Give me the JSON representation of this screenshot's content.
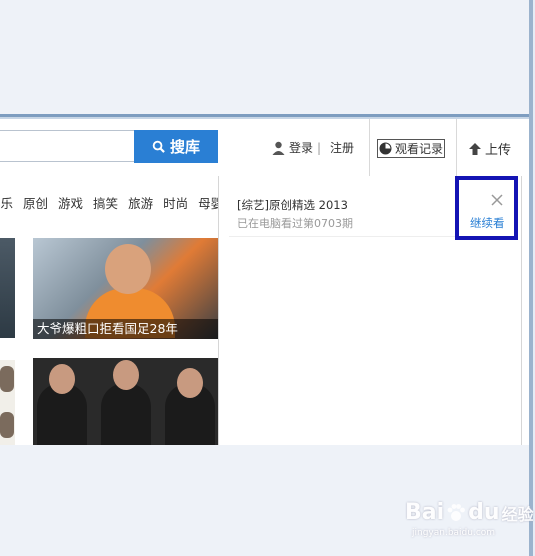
{
  "search": {
    "button_label": "搜库",
    "value": ""
  },
  "header": {
    "login": "登录",
    "divider": "|",
    "register": "注册",
    "history": "观看记录",
    "upload": "上传"
  },
  "nav": {
    "items": [
      "娱乐",
      "原创",
      "游戏",
      "搞笑",
      "旅游",
      "时尚",
      "母婴"
    ]
  },
  "thumbs": {
    "caption1": "大爷爆粗口拒看国足28年"
  },
  "history_panel": {
    "item_title": "[综艺]原创精选 2013",
    "item_sub": "已在电脑看过第0703期",
    "continue_label": "继续看"
  },
  "watermark": {
    "brand": "Bai",
    "brand2": "du",
    "brand3": "经验",
    "url": "jingyan.baidu.com"
  },
  "colors": {
    "accent": "#2a7fd4",
    "highlight": "#1414b4"
  }
}
